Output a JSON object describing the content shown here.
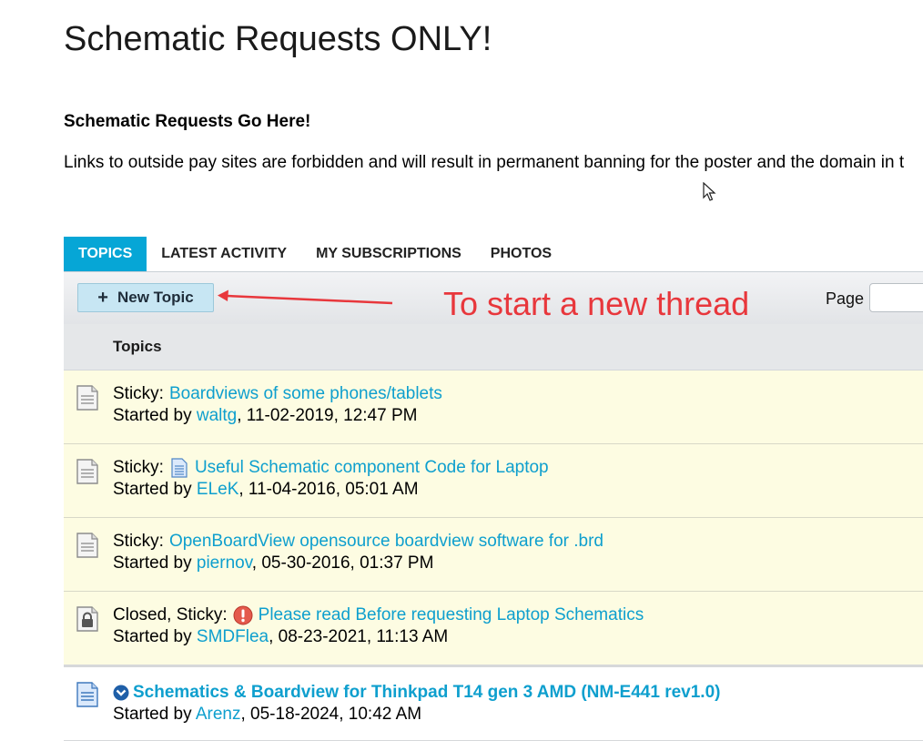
{
  "forum": {
    "title": "Schematic Requests ONLY!",
    "description_heading": "Schematic Requests Go Here!",
    "description_text": "Links to outside pay sites are forbidden and will result in permanent banning for the poster and the domain in t"
  },
  "tabs": [
    {
      "label": "TOPICS",
      "active": true
    },
    {
      "label": "LATEST ACTIVITY"
    },
    {
      "label": "MY SUBSCRIPTIONS"
    },
    {
      "label": "PHOTOS"
    }
  ],
  "toolbar": {
    "new_topic_label": "New Topic",
    "page_label": "Page",
    "page_value": ""
  },
  "annotation": {
    "text": "To start a new thread",
    "color": "#e8373c"
  },
  "list": {
    "header": "Topics",
    "topics": [
      {
        "prefix": "Sticky:",
        "title": "Boardviews of some phones/tablets",
        "started_by_label": "Started by",
        "author": "waltg",
        "date": ", 11-02-2019, 12:47 PM",
        "icon": "document-icon"
      },
      {
        "prefix": "Sticky:",
        "title": "Useful Schematic component Code for Laptop",
        "started_by_label": "Started by",
        "author": "ELeK",
        "date": ", 11-04-2016, 05:01 AM",
        "icon": "document-icon",
        "title_icon": "blue-document-icon"
      },
      {
        "prefix": "Sticky:",
        "title": "OpenBoardView opensource boardview software for .brd",
        "started_by_label": "Started by",
        "author": "piernov",
        "date": ", 05-30-2016, 01:37 PM",
        "icon": "document-icon"
      },
      {
        "prefix": "Closed, Sticky:",
        "title": "Please read Before requesting Laptop Schematics",
        "started_by_label": "Started by",
        "author": "SMDFlea",
        "date": ", 08-23-2021, 11:13 AM",
        "icon": "lock-document-icon",
        "title_icon": "alert-icon"
      },
      {
        "prefix": "",
        "title": "Schematics & Boardview for Thinkpad T14 gen 3 AMD (NM-E441 rev1.0)",
        "started_by_label": "Started by",
        "author": "Arenz",
        "date": ", 05-18-2024, 10:42 AM",
        "icon": "unread-document-icon",
        "title_icon": "go-to-first-unread-icon"
      }
    ]
  },
  "colors": {
    "accent": "#06a6d6",
    "link": "#0e9fce",
    "sticky_bg": "#fdfce2"
  }
}
